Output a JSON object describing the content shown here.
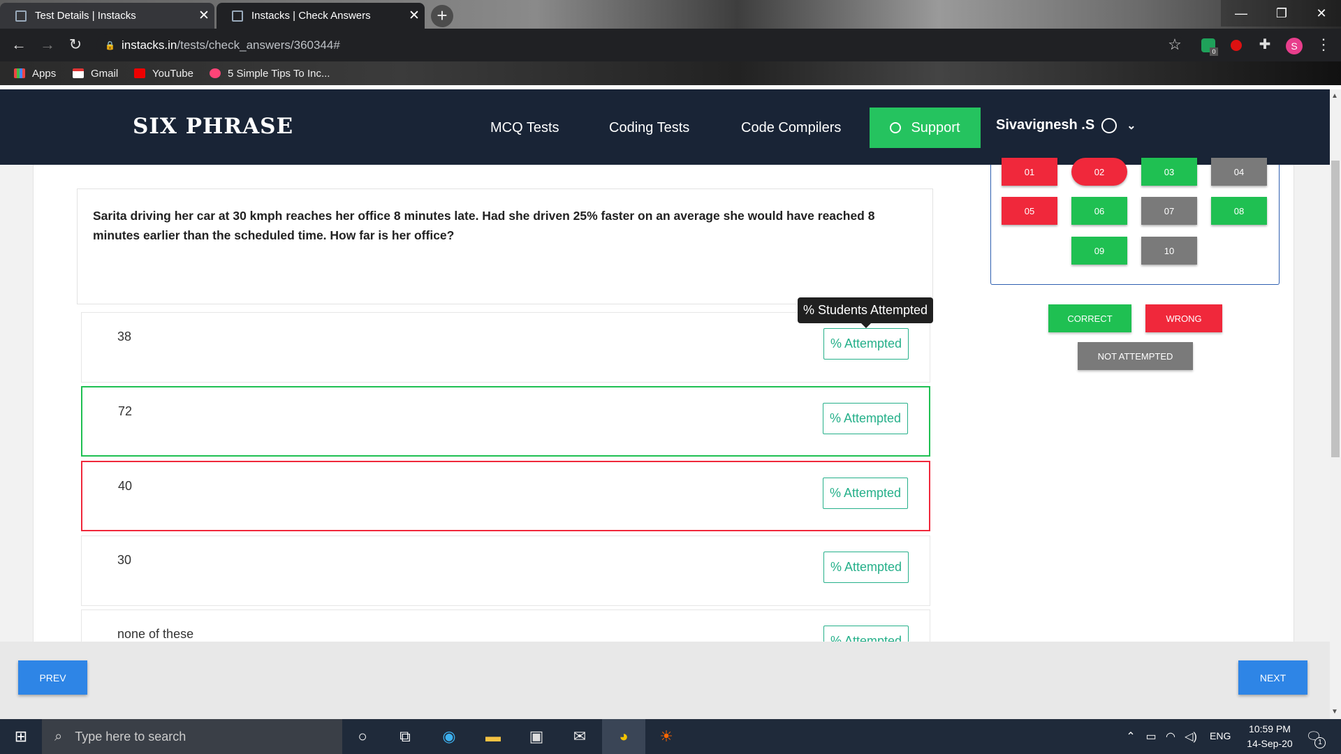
{
  "browser": {
    "tabs": [
      {
        "title": "Test Details | Instacks"
      },
      {
        "title": "Instacks | Check Answers"
      }
    ],
    "url_host": "instacks.in",
    "url_path": "/tests/check_answers/360344#",
    "bookmarks": [
      "Apps",
      "Gmail",
      "YouTube",
      "5 Simple Tips To Inc..."
    ],
    "profile_initial": "S",
    "extension_badge": "0"
  },
  "site": {
    "logo": "SIX PHRASE",
    "nav": [
      "MCQ Tests",
      "Coding Tests",
      "Code Compilers"
    ],
    "support_label": "Support",
    "user_name": "Sivavignesh .S"
  },
  "question": {
    "text": "Sarita driving her car at 30 kmph reaches her office 8 minutes late. Had she driven 25% faster on an average she would have reached 8 minutes earlier than the scheduled time. How far is her office?",
    "attempted_label": "% Attempted",
    "tooltip": "% Students Attempted",
    "options": [
      {
        "text": "38",
        "state": "none"
      },
      {
        "text": "72",
        "state": "correct"
      },
      {
        "text": "40",
        "state": "wrong"
      },
      {
        "text": "30",
        "state": "none"
      },
      {
        "text": "none of these",
        "state": "none"
      }
    ]
  },
  "palette": {
    "questions": [
      {
        "num": "01",
        "status": "wrong"
      },
      {
        "num": "02",
        "status": "wrong"
      },
      {
        "num": "03",
        "status": "correct"
      },
      {
        "num": "04",
        "status": "not-attempted"
      },
      {
        "num": "05",
        "status": "wrong"
      },
      {
        "num": "06",
        "status": "correct"
      },
      {
        "num": "07",
        "status": "not-attempted"
      },
      {
        "num": "08",
        "status": "correct"
      },
      {
        "num": "09",
        "status": "correct"
      },
      {
        "num": "10",
        "status": "not-attempted"
      }
    ],
    "legend": {
      "correct": "CORRECT",
      "wrong": "WRONG",
      "not_attempted": "NOT ATTEMPTED"
    }
  },
  "footer": {
    "prev": "PREV",
    "next": "NEXT"
  },
  "taskbar": {
    "search_placeholder": "Type here to search",
    "time": "10:59 PM",
    "date": "14-Sep-20",
    "lang": "ENG",
    "notif_count": "1"
  },
  "colors": {
    "correct": "#1fc052",
    "wrong": "#f0283b",
    "not_attempted": "#7a7a7a",
    "accent": "#2e85e6",
    "header": "#192436",
    "support": "#25c35f"
  }
}
